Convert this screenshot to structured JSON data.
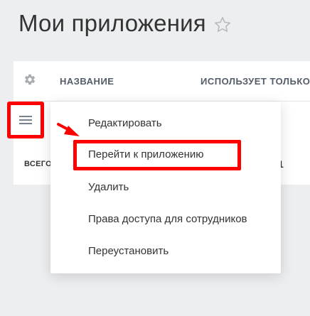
{
  "page": {
    "title": "Мои приложения"
  },
  "table": {
    "columns": [
      {
        "label": "НАЗВАНИЕ"
      },
      {
        "label": "ИСПОЛЬЗУЕТ ТОЛЬКО"
      }
    ],
    "footer": {
      "total_label": "ВСЕГО",
      "right_fragment": "1"
    }
  },
  "context_menu": {
    "items": [
      {
        "label": "Редактировать"
      },
      {
        "label": "Перейти к приложению"
      },
      {
        "label": "Удалить"
      },
      {
        "label": "Права доступа для сотрудников"
      },
      {
        "label": "Переустановить"
      }
    ],
    "highlighted_item_index": 1
  },
  "icons": {
    "favorite": "star-outline-icon",
    "settings": "gear-icon",
    "row_menu": "hamburger-menu-icon",
    "pointer": "red-arrow-icon"
  },
  "colors": {
    "background": "#edeef0",
    "panel": "#ffffff",
    "title_text": "#333333",
    "header_text": "#535c69",
    "icon_gray": "#a8adb4",
    "annotation_red": "#ff0000"
  }
}
